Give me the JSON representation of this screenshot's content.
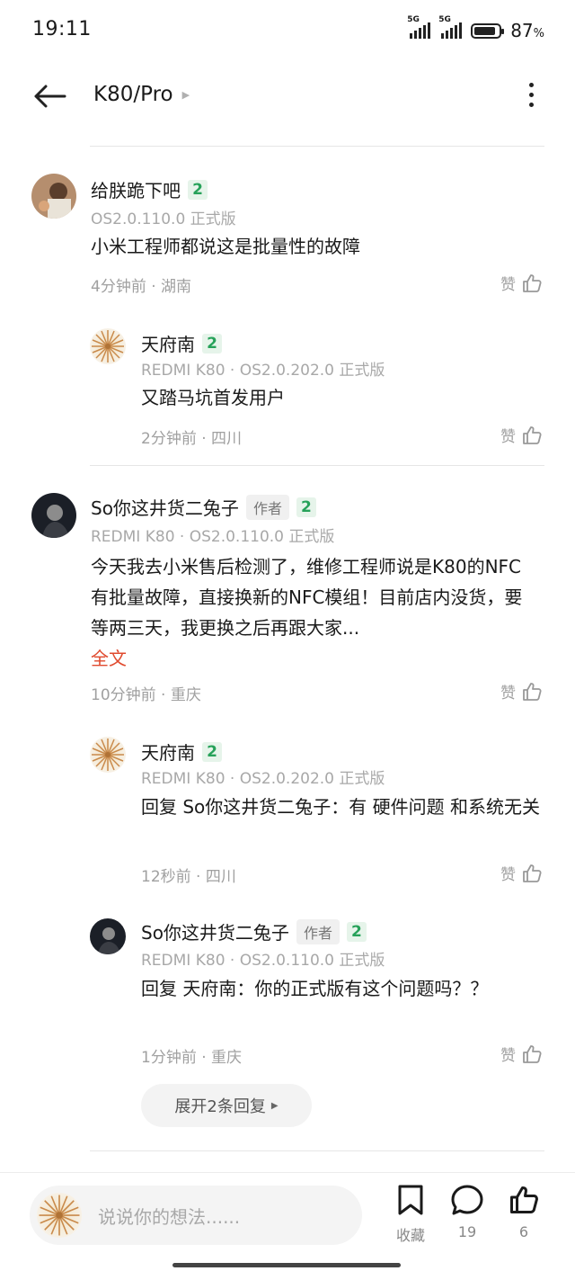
{
  "status_bar": {
    "time": "19:11",
    "net1": "5G",
    "net2": "5G",
    "battery_pct": "87",
    "pct_sign": "%",
    "battery_level": 0.87
  },
  "header": {
    "title": "K80/Pro"
  },
  "comments": [
    {
      "name": "给朕跪下吧",
      "level": "2",
      "device": "OS2.0.110.0 正式版",
      "text": "小米工程师都说这是批量性的故障",
      "time": "4分钟前 · 湖南",
      "like_label": "赞"
    },
    {
      "name": "天府南",
      "level": "2",
      "device": "REDMI K80 · OS2.0.202.0 正式版",
      "text": "又踏马坑首发用户",
      "time": "2分钟前 · 四川",
      "like_label": "赞"
    },
    {
      "name": "So你这井货二兔子",
      "author_tag": "作者",
      "level": "2",
      "device": "REDMI K80 · OS2.0.110.0 正式版",
      "text": "今天我去小米售后检测了，维修工程师说是K80的NFC有批量故障，直接换新的NFC模组！目前店内没货，要等两三天，我更换之后再跟大家...",
      "full_text_link": "全文",
      "time": "10分钟前 · 重庆",
      "like_label": "赞"
    },
    {
      "name": "天府南",
      "level": "2",
      "device": "REDMI K80 · OS2.0.202.0 正式版",
      "text": "回复 So你这井货二兔子：有 硬件问题 和系统无关",
      "time": "12秒前 · 四川",
      "like_label": "赞"
    },
    {
      "name": "So你这井货二兔子",
      "author_tag": "作者",
      "level": "2",
      "device": "REDMI K80 · OS2.0.110.0 正式版",
      "text": "回复 天府南：你的正式版有这个问题吗？？",
      "time": "1分钟前 · 重庆",
      "like_label": "赞"
    }
  ],
  "expand_replies": "展开2条回复",
  "bottom_bar": {
    "placeholder": "说说你的想法......",
    "favorite_label": "收藏",
    "comment_count": "19",
    "like_count": "6"
  },
  "icons": [
    "back-arrow-icon",
    "more-vertical-icon",
    "thumbs-up-icon",
    "bookmark-icon",
    "comment-bubble-icon"
  ]
}
